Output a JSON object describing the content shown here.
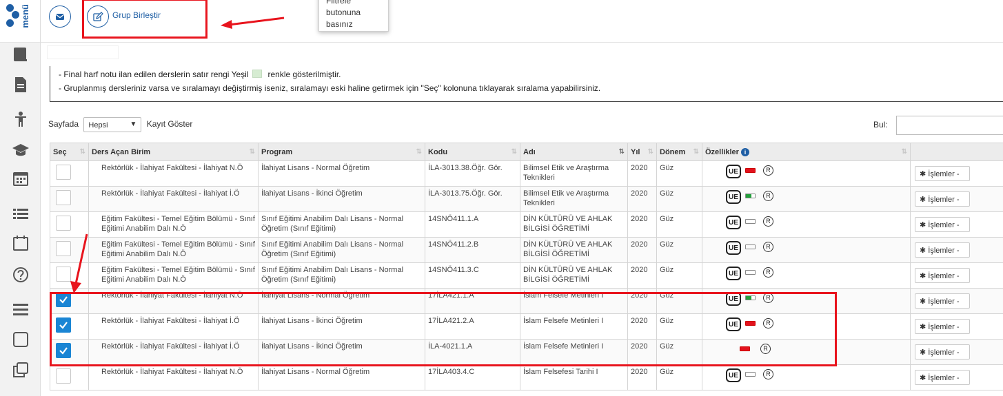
{
  "logo": {
    "text": "menü"
  },
  "toolbar": {
    "group_merge_label": "Grup Birleştir"
  },
  "tooltip": {
    "lines": [
      "Filtrele",
      "butonuna",
      "basınız"
    ]
  },
  "notes": {
    "line1_before": "- Final harf notu ilan edilen derslerin satır rengi Yeşil",
    "line1_after": "renkle gösterilmiştir.",
    "line2": "- Gruplanmış dersleriniz varsa ve sıralamayı değiştirmiş iseniz, sıralamayı eski haline getirmek için \"Seç\" kolonuna tıklayarak sıralama yapabilirsiniz."
  },
  "paging": {
    "prefix": "Sayfada",
    "selected": "Hepsi",
    "suffix": "Kayıt Göster"
  },
  "search": {
    "label": "Bul:",
    "value": ""
  },
  "colors": {
    "accent": "#1f5fa5",
    "checkbox_on": "#1a85d4",
    "highlight": "#e8141d",
    "final_green": "#d6ecd2"
  },
  "table": {
    "headers": [
      "Seç",
      "Ders Açan Birim",
      "Program",
      "Kodu",
      "Adı",
      "Yıl",
      "Dönem",
      "Özellikler",
      ""
    ],
    "action_label": "İşlemler -",
    "rows": [
      {
        "checked": false,
        "birim": "Rektörlük - İlahiyat Fakültesi - İlahiyat N.Ö",
        "program": "İlahiyat Lisans - Normal Öğretim",
        "kodu": "İLA-3013.38.Öğr. Gör.",
        "adi": "Bilimsel Etik ve Araştırma Teknikleri",
        "yil": "2020",
        "donem": "Güz",
        "ue": true,
        "indicator": "red"
      },
      {
        "checked": false,
        "birim": "Rektörlük - İlahiyat Fakültesi - İlahiyat İ.Ö",
        "program": "İlahiyat Lisans - İkinci Öğretim",
        "kodu": "İLA-3013.75.Öğr. Gör.",
        "adi": "Bilimsel Etik ve Araştırma Teknikleri",
        "yil": "2020",
        "donem": "Güz",
        "ue": true,
        "indicator": "green"
      },
      {
        "checked": false,
        "birim": "Eğitim Fakültesi - Temel Eğitim Bölümü - Sınıf Eğitimi Anabilim Dalı N.Ö",
        "program": "Sınıf Eğitimi Anabilim Dalı Lisans - Normal Öğretim (Sınıf Eğitimi)",
        "kodu": "14SNÖ411.1.A",
        "adi": "DİN KÜLTÜRÜ VE AHLAK BİLGİSİ ÖĞRETİMİ",
        "yil": "2020",
        "donem": "Güz",
        "ue": true,
        "indicator": "empty"
      },
      {
        "checked": false,
        "birim": "Eğitim Fakültesi - Temel Eğitim Bölümü - Sınıf Eğitimi Anabilim Dalı N.Ö",
        "program": "Sınıf Eğitimi Anabilim Dalı Lisans - Normal Öğretim (Sınıf Eğitimi)",
        "kodu": "14SNÖ411.2.B",
        "adi": "DİN KÜLTÜRÜ VE AHLAK BİLGİSİ ÖĞRETİMİ",
        "yil": "2020",
        "donem": "Güz",
        "ue": true,
        "indicator": "empty"
      },
      {
        "checked": false,
        "birim": "Eğitim Fakültesi - Temel Eğitim Bölümü - Sınıf Eğitimi Anabilim Dalı N.Ö",
        "program": "Sınıf Eğitimi Anabilim Dalı Lisans - Normal Öğretim (Sınıf Eğitimi)",
        "kodu": "14SNÖ411.3.C",
        "adi": "DİN KÜLTÜRÜ VE AHLAK BİLGİSİ ÖĞRETİMİ",
        "yil": "2020",
        "donem": "Güz",
        "ue": true,
        "indicator": "empty"
      },
      {
        "checked": true,
        "birim": "Rektörlük - İlahiyat Fakültesi - İlahiyat N.Ö",
        "program": "İlahiyat Lisans - Normal Öğretim",
        "kodu": "17İLA421.1.A",
        "adi": "İslam Felsefe Metinleri I",
        "yil": "2020",
        "donem": "Güz",
        "ue": true,
        "indicator": "green"
      },
      {
        "checked": true,
        "birim": "Rektörlük - İlahiyat Fakültesi - İlahiyat İ.Ö",
        "program": "İlahiyat Lisans - İkinci Öğretim",
        "kodu": "17İLA421.2.A",
        "adi": "İslam Felsefe Metinleri I",
        "yil": "2020",
        "donem": "Güz",
        "ue": true,
        "indicator": "red"
      },
      {
        "checked": true,
        "birim": "Rektörlük - İlahiyat Fakültesi - İlahiyat İ.Ö",
        "program": "İlahiyat Lisans - İkinci Öğretim",
        "kodu": "İLA-4021.1.A",
        "adi": "İslam Felsefe Metinleri I",
        "yil": "2020",
        "donem": "Güz",
        "ue": false,
        "indicator": "red"
      },
      {
        "checked": false,
        "birim": "Rektörlük - İlahiyat Fakültesi - İlahiyat N.Ö",
        "program": "İlahiyat Lisans - Normal Öğretim",
        "kodu": "17İLA403.4.C",
        "adi": "İslam Felsefesi Tarihi I",
        "yil": "2020",
        "donem": "Güz",
        "ue": true,
        "indicator": "empty"
      }
    ]
  }
}
